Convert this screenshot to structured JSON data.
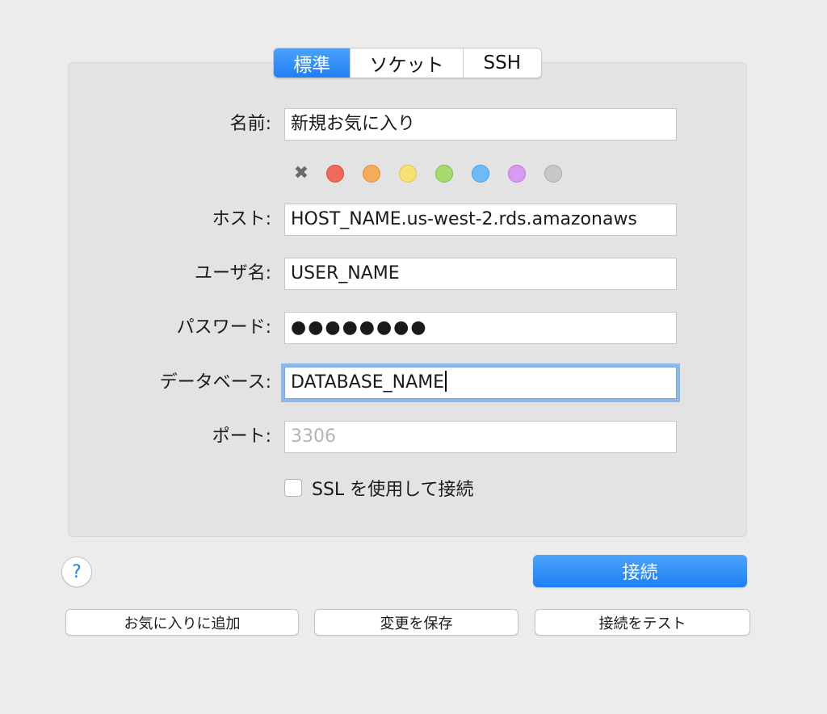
{
  "tabs": [
    {
      "label": "標準",
      "active": true
    },
    {
      "label": "ソケット",
      "active": false
    },
    {
      "label": "SSH",
      "active": false
    }
  ],
  "form": {
    "name": {
      "label": "名前:",
      "value": "新規お気に入り"
    },
    "host": {
      "label": "ホスト:",
      "value": "HOST_NAME.us-west-2.rds.amazonaws"
    },
    "username": {
      "label": "ユーザ名:",
      "value": "USER_NAME"
    },
    "password": {
      "label": "パスワード:",
      "value": "●●●●●●●●"
    },
    "database": {
      "label": "データベース:",
      "value": "DATABASE_NAME"
    },
    "port": {
      "label": "ポート:",
      "placeholder": "3306"
    }
  },
  "color_tags": {
    "clear_icon": "✖",
    "colors": [
      "#f0695d",
      "#f7aa57",
      "#f8e071",
      "#a3dc6c",
      "#6cbcfa",
      "#d99af4",
      "#c8c8c8"
    ],
    "borders": [
      "#d6473b",
      "#e08c33",
      "#e0c44e",
      "#7fbc4a",
      "#3f9be6",
      "#b876d6",
      "#a8a8a8"
    ]
  },
  "ssl": {
    "label": "SSL を使用して接続",
    "checked": false
  },
  "help_button": {
    "label": "?"
  },
  "connect_button": {
    "label": "接続"
  },
  "actions": {
    "add_favorite": "お気に入りに追加",
    "save_changes": "変更を保存",
    "test_connection": "接続をテスト"
  },
  "colors": {
    "accent": "#1f7ff3",
    "focus_ring": "#8cb8ec"
  }
}
